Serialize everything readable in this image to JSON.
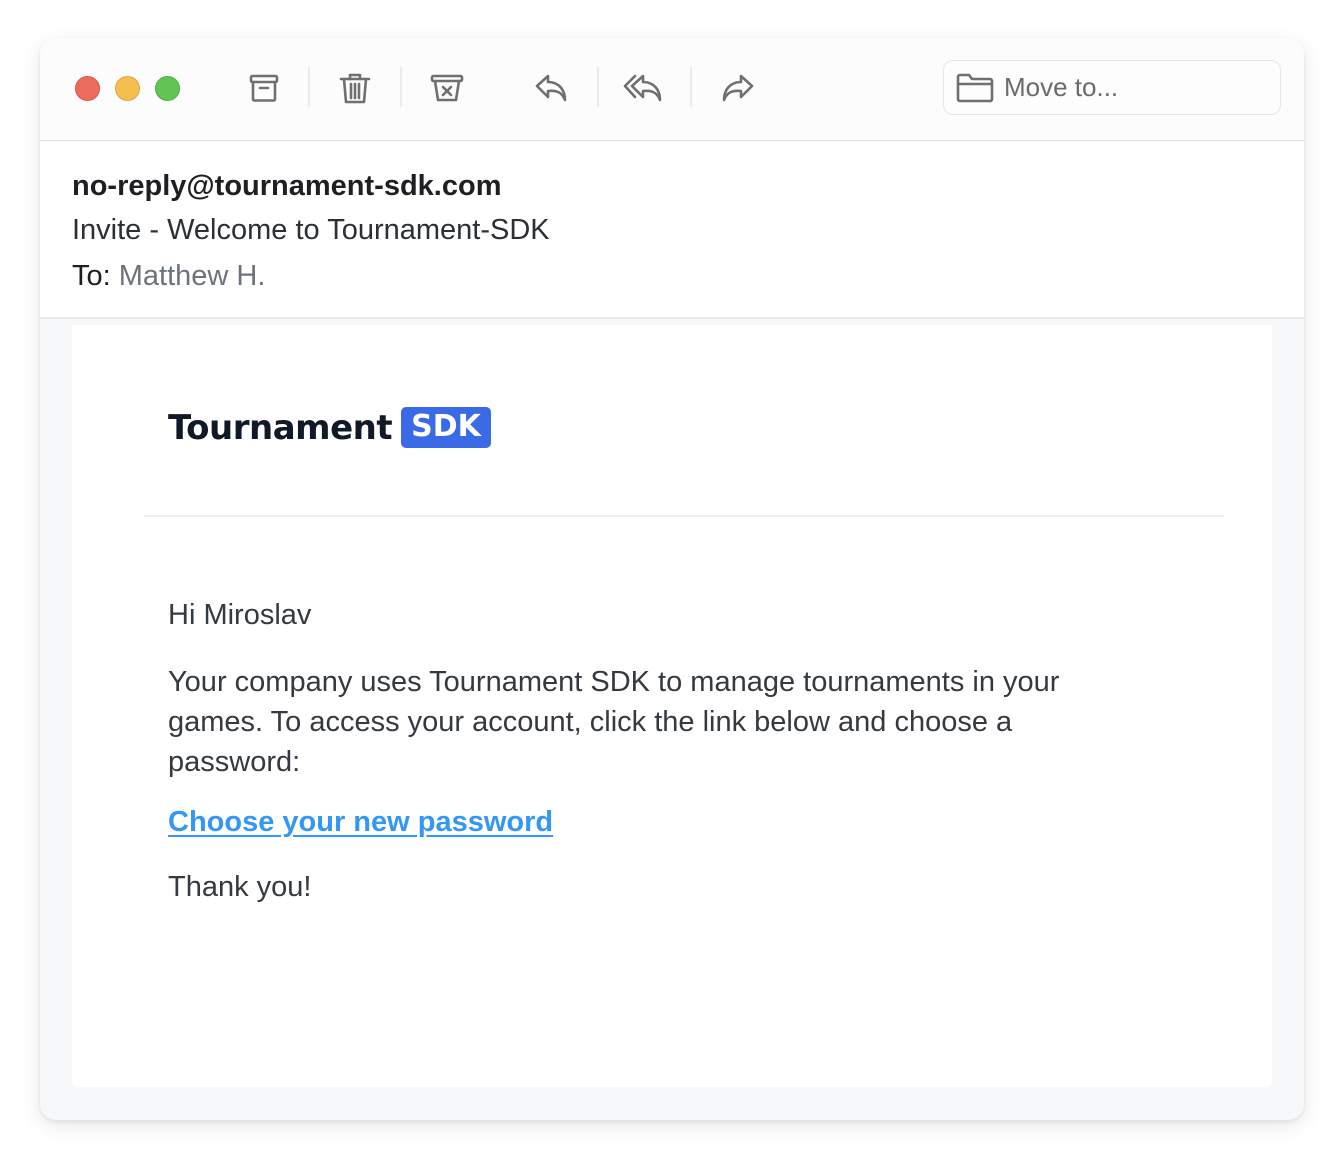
{
  "window": {
    "traffic_lights": {
      "close": "#ed6a5e",
      "minimize": "#f5bf4f",
      "maximize": "#61c554"
    }
  },
  "toolbar": {
    "buttons": [
      {
        "name": "archive",
        "icon": "archive-icon"
      },
      {
        "name": "delete",
        "icon": "trash-icon"
      },
      {
        "name": "junk",
        "icon": "junk-icon"
      },
      {
        "name": "reply",
        "icon": "reply-icon"
      },
      {
        "name": "reply-all",
        "icon": "reply-all-icon"
      },
      {
        "name": "forward",
        "icon": "forward-icon"
      }
    ],
    "move_to": {
      "icon": "folder-icon",
      "label": "Move to..."
    }
  },
  "email": {
    "from": "no-reply@tournament-sdk.com",
    "subject": "Invite - Welcome to Tournament-SDK",
    "to_label": "To:",
    "to": "Matthew H."
  },
  "body": {
    "logo": {
      "text": "Tournament",
      "badge": "SDK",
      "badge_color": "#3b6ae6"
    },
    "greeting": "Hi Miroslav",
    "paragraph": "Your company uses Tournament SDK to manage tournaments in your games. To access your account, click the link below and choose a password:",
    "link_text": "Choose your new password",
    "link_color": "#3398f5",
    "closing": "Thank you!"
  }
}
